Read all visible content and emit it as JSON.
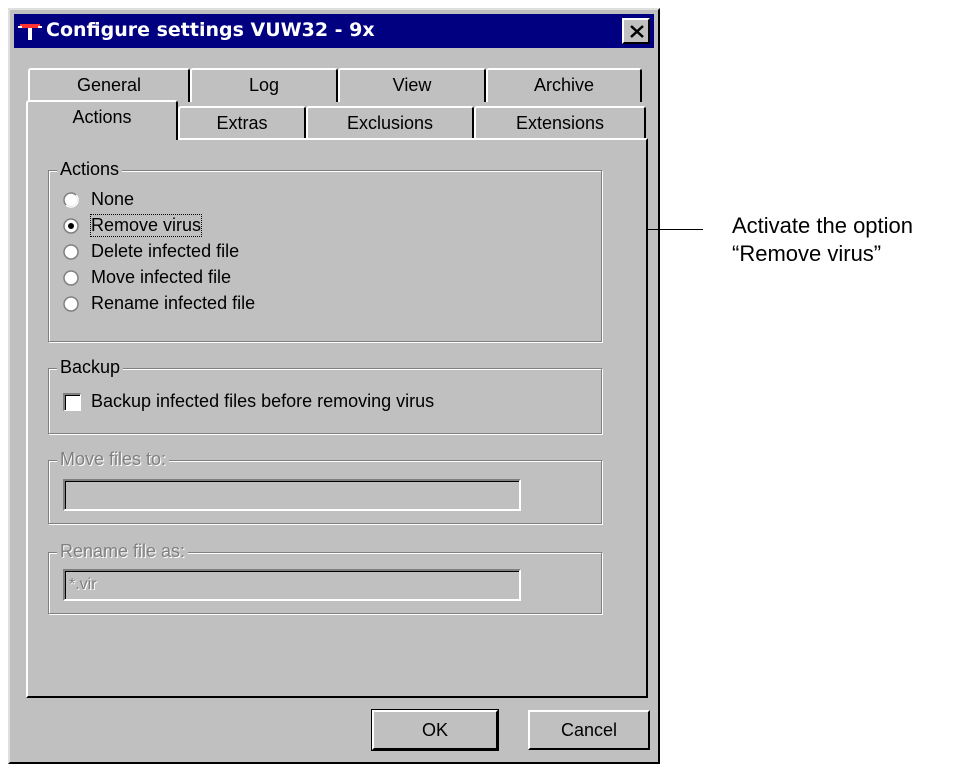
{
  "window": {
    "title": "Configure settings  VUW32 - 9x"
  },
  "tabs_back": [
    {
      "label": "General"
    },
    {
      "label": "Log"
    },
    {
      "label": "View"
    },
    {
      "label": "Archive"
    }
  ],
  "tabs_front": [
    {
      "label": "Actions",
      "active": true
    },
    {
      "label": "Extras"
    },
    {
      "label": "Exclusions"
    },
    {
      "label": "Extensions"
    }
  ],
  "actions_group": {
    "legend": "Actions",
    "options": [
      {
        "label": "None",
        "selected": false
      },
      {
        "label": "Remove virus",
        "selected": true
      },
      {
        "label": "Delete infected file",
        "selected": false
      },
      {
        "label": "Move infected file",
        "selected": false
      },
      {
        "label": "Rename infected file",
        "selected": false
      }
    ]
  },
  "backup_group": {
    "legend": "Backup",
    "checkbox_label": "Backup infected files before removing virus",
    "checked": false
  },
  "move_group": {
    "legend": "Move files to:",
    "value": ""
  },
  "rename_group": {
    "legend": "Rename file as:",
    "value": "*.vir"
  },
  "buttons": {
    "ok": "OK",
    "cancel": "Cancel"
  },
  "callout": {
    "line1": "Activate the option",
    "line2": "“Remove virus”"
  },
  "colors": {
    "face": "#c0c0c0",
    "titlebar": "#000080",
    "disabled_text": "#808080"
  }
}
